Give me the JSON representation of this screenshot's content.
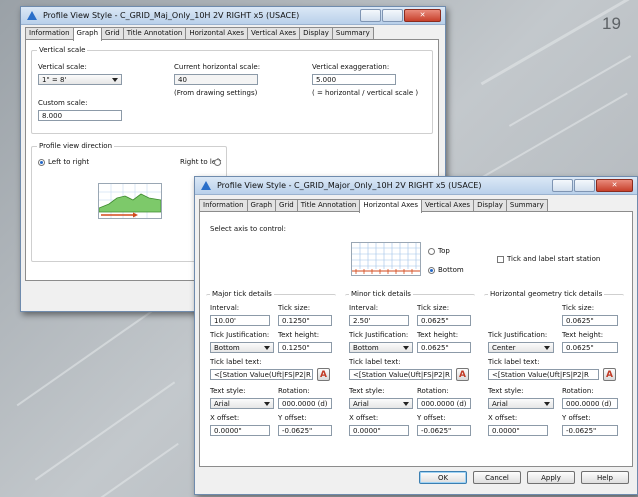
{
  "slide_number": "19",
  "back_dialog": {
    "title": "Profile View Style - C_GRID_Maj_Only_10H 2V RIGHT x5 (USACE)",
    "tabs": [
      "Information",
      "Graph",
      "Grid",
      "Title Annotation",
      "Horizontal Axes",
      "Vertical Axes",
      "Display",
      "Summary"
    ],
    "active_tab": "Graph",
    "vertical_scale": {
      "group_title": "Vertical scale",
      "scale_label": "Vertical scale:",
      "scale_value": "1\" = 8'",
      "custom_label": "Custom scale:",
      "custom_value": "8.000",
      "h_scale_label": "Current horizontal scale:",
      "h_scale_value": "40",
      "h_scale_note": "(From drawing settings)",
      "exag_label": "Vertical exaggeration:",
      "exag_value": "5.000",
      "exag_note": "( = horizontal / vertical scale )"
    },
    "direction": {
      "group_title": "Profile view direction",
      "left_to_right": "Left to right",
      "right_to_left": "Right to left",
      "selected": "left_to_right"
    }
  },
  "front_dialog": {
    "title": "Profile View Style - C_GRID_Major_Only_10H 2V RIGHT x5 (USACE)",
    "tabs": [
      "Information",
      "Graph",
      "Grid",
      "Title Annotation",
      "Horizontal Axes",
      "Vertical Axes",
      "Display",
      "Summary"
    ],
    "active_tab": "Horizontal Axes",
    "select_axis_label": "Select axis to control:",
    "axis_top": "Top",
    "axis_bottom": "Bottom",
    "selected_axis": "Bottom",
    "tick_start_label": "Tick and label start station",
    "columns": [
      {
        "title": "Major tick details",
        "interval_label": "Interval:",
        "interval": "10.00'",
        "tick_size_label": "Tick size:",
        "tick_size": "0.1250\"",
        "justification_label": "Tick Justification:",
        "justification": "Bottom",
        "text_height_label": "Text height:",
        "text_height": "0.1250\"",
        "label_text_label": "Tick label text:",
        "label_text": "<[Station Value(Uft|FS|P2|R",
        "text_style_label": "Text style:",
        "text_style": "Arial",
        "rotation_label": "Rotation:",
        "rotation": "000.0000 (d)",
        "x_offset_label": "X offset:",
        "x_offset": "0.0000\"",
        "y_offset_label": "Y offset:",
        "y_offset": "-0.0625\""
      },
      {
        "title": "Minor tick details",
        "interval_label": "Interval:",
        "interval": "2.50'",
        "tick_size_label": "Tick size:",
        "tick_size": "0.0625\"",
        "justification_label": "Tick Justification:",
        "justification": "Bottom",
        "text_height_label": "Text height:",
        "text_height": "0.0625\"",
        "label_text_label": "Tick label text:",
        "label_text": "<[Station Value(Uft|FS|P2|R",
        "text_style_label": "Text style:",
        "text_style": "Arial",
        "rotation_label": "Rotation:",
        "rotation": "000.0000 (d)",
        "x_offset_label": "X offset:",
        "x_offset": "0.0000\"",
        "y_offset_label": "Y offset:",
        "y_offset": "-0.0625\""
      },
      {
        "title": "Horizontal geometry tick details",
        "tick_size_label": "Tick size:",
        "tick_size": "0.0625\"",
        "justification_label": "Tick Justification:",
        "justification": "Center",
        "text_height_label": "Text height:",
        "text_height": "0.0625\"",
        "label_text_label": "Tick label text:",
        "label_text": "<[Station Value(Uft|FS|P2|R",
        "text_style_label": "Text style:",
        "text_style": "Arial",
        "rotation_label": "Rotation:",
        "rotation": "000.0000 (d)",
        "x_offset_label": "X offset:",
        "x_offset": "0.0000\"",
        "y_offset_label": "Y offset:",
        "y_offset": "-0.0625\""
      }
    ],
    "buttons": {
      "ok": "OK",
      "cancel": "Cancel",
      "apply": "Apply",
      "help": "Help"
    }
  },
  "colors": {
    "accent": "#2a6fc9",
    "title_bar": "#c8dcf1",
    "close_button": "#c7402b",
    "grid_line": "#9fc1e8",
    "profile_fill": "#7dc96a"
  }
}
